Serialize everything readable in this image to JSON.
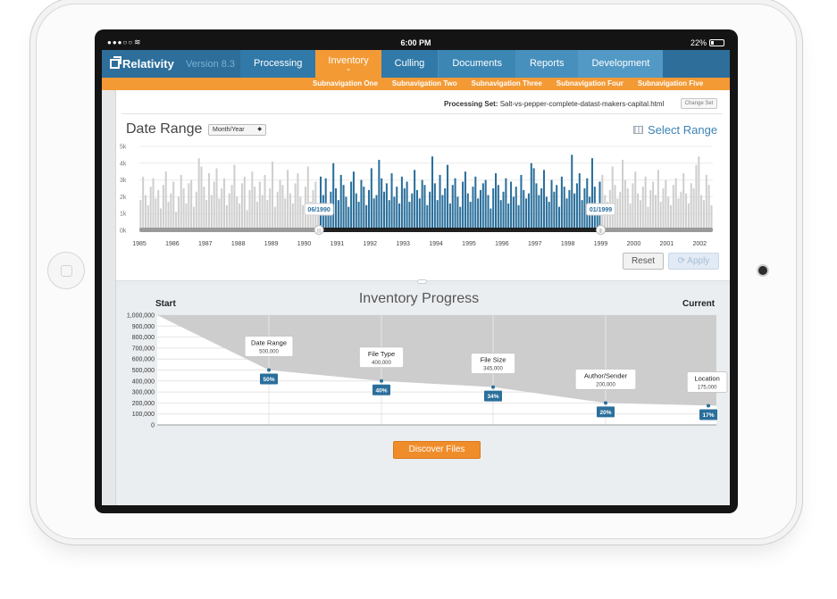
{
  "status_bar": {
    "time": "6:00 PM",
    "battery": "22%"
  },
  "header": {
    "logo": "Relativity",
    "version": "Version 8.3",
    "nav": [
      {
        "label": "Processing"
      },
      {
        "label": "Inventory",
        "active": true
      },
      {
        "label": "Culling"
      },
      {
        "label": "Documents"
      },
      {
        "label": "Reports"
      },
      {
        "label": "Development"
      }
    ],
    "subnav": [
      "Subnavigation One",
      "Subnavigation Two",
      "Subnavigation Three",
      "Subnavigation Four",
      "Subnavigation Five"
    ]
  },
  "processing_set": {
    "label": "Processing Set:",
    "value": "Salt-vs-pepper-complete-datast-makers-capital.html",
    "change_label": "Change Set"
  },
  "date_range": {
    "title": "Date Range",
    "select_value": "Month/Year",
    "select_range_label": "Select Range",
    "reset_label": "Reset",
    "apply_label": "Apply"
  },
  "colors": {
    "selected_bar": "#2a6f9b",
    "unselected_bar": "#cfcfcf",
    "accent": "#f39a35",
    "brand": "#2d6e9b"
  },
  "chart_data": [
    {
      "type": "bar",
      "y_ticks": [
        "0k",
        "1k",
        "2k",
        "3k",
        "4k",
        "5k"
      ],
      "ylim": [
        0,
        5000
      ],
      "x_ticks": [
        "1985",
        "1986",
        "1987",
        "1988",
        "1989",
        "1990",
        "1991",
        "1992",
        "1993",
        "1994",
        "1995",
        "1996",
        "1997",
        "1998",
        "1999",
        "2000",
        "2001",
        "2002"
      ],
      "xlim": [
        1985,
        2002.4
      ],
      "range_start_label": "06/1990",
      "range_end_label": "01/1999",
      "range_start": 1990.45,
      "range_end": 1999.0,
      "series": [
        {
          "values": [
            1800,
            3200,
            2100,
            1500,
            2600,
            3100,
            1900,
            2400,
            1300,
            2700,
            3500,
            1700,
            2200,
            2900,
            1100,
            2000,
            3300,
            2500,
            1600,
            2800,
            3000,
            1400,
            2300,
            4300,
            3800,
            2600,
            1800,
            3400,
            2100,
            2900,
            3700,
            1900,
            2500,
            3100,
            1500,
            2200,
            2700,
            3900,
            2000,
            1600,
            2800,
            3200,
            1200,
            2400,
            3500,
            2600,
            1700,
            2900,
            2100,
            3300,
            1800,
            2500,
            4100,
            1400,
            2300,
            3000,
            2700,
            1900,
            3600,
            2200,
            1600,
            2800,
            3400,
            2000,
            1500,
            2600,
            3800,
            1700,
            2400,
            2900,
            1300,
            3200,
            2100,
            3100,
            1600,
            2300,
            4000,
            2500,
            1800,
            3300,
            2700,
            2000,
            1400,
            2900,
            3500,
            2200,
            1700,
            3000,
            2600,
            1500,
            2400,
            3700,
            1900,
            2100,
            4200,
            3100,
            2300,
            2800,
            1800,
            3400,
            2000,
            2600,
            1600,
            3200,
            2500,
            2900,
            1700,
            2200,
            3600,
            2400,
            1900,
            3000,
            2700,
            1500,
            2300,
            4400,
            2800,
            1800,
            3300,
            2100,
            2500,
            3900,
            1600,
            2700,
            3100,
            2000,
            1400,
            2900,
            3500,
            2200,
            1700,
            2600,
            3200,
            1900,
            2400,
            2800,
            3000,
            2100,
            1300,
            2500,
            3400,
            2700,
            1800,
            2300,
            3100,
            1600,
            2900,
            2000,
            2600,
            1500,
            3300,
            2400,
            1900,
            2200,
            4000,
            3700,
            2800,
            2100,
            2500,
            3600,
            2000,
            1700,
            3000,
            2300,
            2700,
            1400,
            3200,
            2600,
            1900,
            2400,
            4500,
            2200,
            2800,
            3400,
            1800,
            2500,
            3100,
            2000,
            4300,
            2600,
            1500,
            2900,
            3300,
            2100,
            1700,
            2400,
            3800,
            2700,
            1900,
            2300,
            4200,
            3000,
            2500,
            1600,
            2800,
            3500,
            2200,
            1800,
            2600,
            3200,
            1400,
            2400,
            2900,
            2100,
            3600,
            1700,
            2500,
            3000,
            2000,
            1500,
            2700,
            3100,
            1900,
            2300,
            3400,
            2200,
            1600,
            2800,
            2500,
            3900,
            4400,
            2100,
            1800,
            3300,
            2700,
            1500
          ]
        }
      ]
    },
    {
      "type": "area",
      "title": "Inventory Progress",
      "start_label": "Start",
      "end_label": "Current",
      "y_ticks": [
        "0",
        "100,000",
        "200,000",
        "300,000",
        "400,000",
        "500,000",
        "600,000",
        "700,000",
        "800,000",
        "900,000",
        "1,000,000"
      ],
      "ylim": [
        0,
        1000000
      ],
      "points": [
        {
          "label": "Start",
          "value": 1000000
        },
        {
          "label": "Date Range",
          "value": 500000,
          "value_label": "500,000",
          "pct": "50%"
        },
        {
          "label": "File Type",
          "value": 400000,
          "value_label": "400,000",
          "pct": "40%"
        },
        {
          "label": "File Size",
          "value": 345000,
          "value_label": "345,000",
          "pct": "34%"
        },
        {
          "label": "Author/Sender",
          "value": 200000,
          "value_label": "200,000",
          "pct": "20%"
        },
        {
          "label": "Location",
          "value": 175000,
          "value_label": "175,000",
          "pct": "17%"
        }
      ]
    }
  ],
  "discover_label": "Discover Files"
}
